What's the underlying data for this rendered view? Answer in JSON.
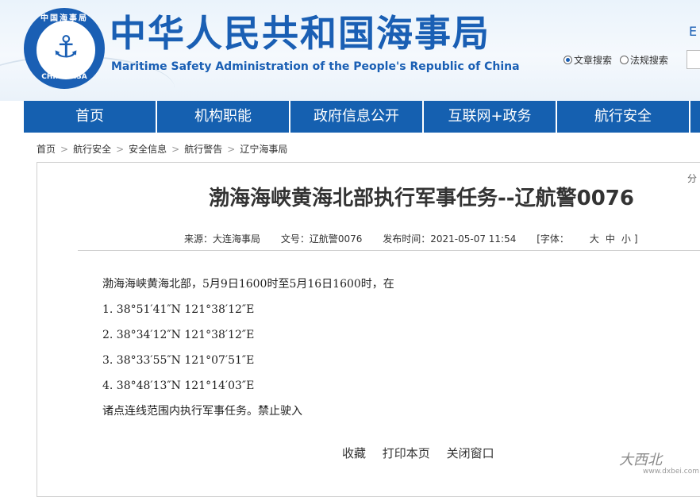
{
  "header": {
    "logo_top_text": "中国海事局",
    "logo_bottom_text": "CHINA MSA",
    "title": "中华人民共和国海事局",
    "subtitle": "Maritime Safety Administration of the People's Republic of China",
    "lang_link": "E",
    "search_options": [
      "文章搜索",
      "法规搜索"
    ],
    "selected_search_option": "文章搜索"
  },
  "nav": {
    "items": [
      {
        "label": "首页"
      },
      {
        "label": "机构职能"
      },
      {
        "label": "政府信息公开"
      },
      {
        "label": "互联网+政务"
      },
      {
        "label": "航行安全"
      }
    ]
  },
  "breadcrumb": [
    "首页",
    "航行安全",
    "安全信息",
    "航行警告",
    "辽宁海事局"
  ],
  "share_label": "分",
  "article": {
    "title": "渤海海峡黄海北部执行军事任务--辽航警0076",
    "source": "来源：大连海事局",
    "doc_no": "文号：辽航警0076",
    "publish_time": "发布时间：2021-05-07 11:54",
    "font_label": "[字体：",
    "font_sizes": [
      "大",
      "中",
      "小"
    ],
    "font_close": "]",
    "lines": [
      "渤海海峡黄海北部，5月9日1600时至5月16日1600时，在",
      "1. 38°51′41″N  121°38′12″E",
      "2. 38°34′12″N  121°38′12″E",
      "3. 38°33′55″N  121°07′51″E",
      "4. 38°48′13″N  121°14′03″E",
      "诸点连线范围内执行军事任务。禁止驶入"
    ]
  },
  "actions": [
    "收藏",
    "打印本页",
    "关闭窗口"
  ],
  "watermark": {
    "text": "大西北",
    "url": "www.dxbei.com"
  },
  "colors": {
    "brand_blue": "#1a5fb4",
    "nav_blue": "#1560b0"
  }
}
